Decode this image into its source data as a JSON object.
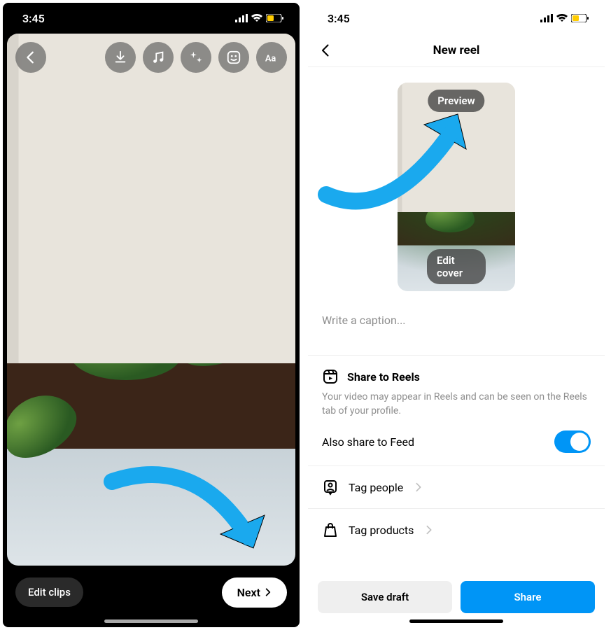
{
  "status": {
    "time": "3:45"
  },
  "left": {
    "toolbar": {
      "back": "back-icon",
      "items": [
        "download-icon",
        "music-icon",
        "sparkles-icon",
        "sticker-icon",
        "text-icon"
      ]
    },
    "bottom": {
      "edit_clips": "Edit clips",
      "next": "Next"
    }
  },
  "right": {
    "nav": {
      "title": "New reel"
    },
    "thumbnail": {
      "preview": "Preview",
      "edit_cover": "Edit cover"
    },
    "caption": {
      "placeholder": "Write a caption..."
    },
    "share_section": {
      "title": "Share to Reels",
      "desc": "Your video may appear in Reels and can be seen on the Reels tab of your profile.",
      "feed_label": "Also share to Feed",
      "feed_on": true
    },
    "tag_people": "Tag people",
    "tag_products": "Tag products",
    "footer": {
      "save_draft": "Save draft",
      "share": "Share"
    }
  }
}
